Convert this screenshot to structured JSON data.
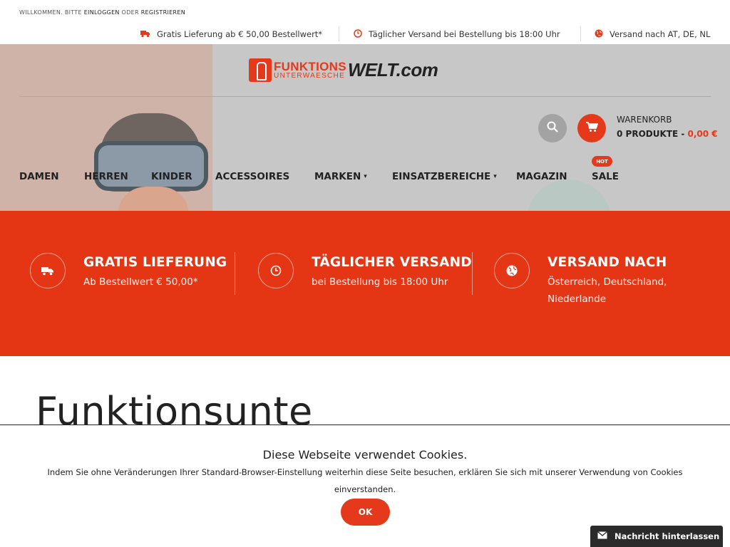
{
  "topbar": {
    "welcome_prefix": "WILLKOMMEN. BITTE ",
    "login_link": "EINLOGGEN",
    "welcome_middle": " ODER ",
    "register_link": "REGISTRIEREN",
    "usps": [
      {
        "icon": "truck-icon",
        "text": "Gratis Lieferung ab € 50,00 Bestellwert*"
      },
      {
        "icon": "clock-icon",
        "text": "Täglicher Versand bei Bestellung bis 18:00 Uhr"
      },
      {
        "icon": "globe-icon",
        "text": "Versand nach AT, DE, NL"
      }
    ]
  },
  "logo": {
    "line1": "FUNKTIONS",
    "line2": "UNTERWAESCHE",
    "line3": "WELT.com"
  },
  "cart": {
    "label": "WARENKORB",
    "count_text": "0 PRODUKTE",
    "separator": " - ",
    "price": "0,00 €"
  },
  "nav": {
    "items": [
      "DAMEN",
      "HERREN",
      "KINDER",
      "ACCESSOIRES",
      "MARKEN",
      "EINSATZBEREICHE",
      "MAGAZIN",
      "SALE"
    ],
    "hot_badge": "HOT"
  },
  "features": [
    {
      "icon": "truck-icon",
      "title": "GRATIS LIEFERUNG",
      "sub": "Ab Bestellwert € 50,00*"
    },
    {
      "icon": "clock-icon",
      "title": "TÄGLICHER VERSAND",
      "sub": "bei Bestellung bis 18:00 Uhr"
    },
    {
      "icon": "globe-icon",
      "title": "VERSAND NACH",
      "sub": "Österreich, Deutschland, Niederlande"
    }
  ],
  "page": {
    "heading": "Funktionsunte"
  },
  "cookie": {
    "title": "Diese Webseite verwendet Cookies.",
    "text": "Indem Sie ohne Veränderungen Ihrer Standard-Browser-Einstellung weiterhin diese Seite besuchen, erklären Sie sich mit unserer Verwendung von Cookies einverstanden.",
    "ok_label": "OK"
  },
  "message_widget": {
    "label": "Nachricht hinterlassen"
  },
  "colors": {
    "accent": "#e4391b",
    "band": "#e43614",
    "dark": "#222222"
  }
}
